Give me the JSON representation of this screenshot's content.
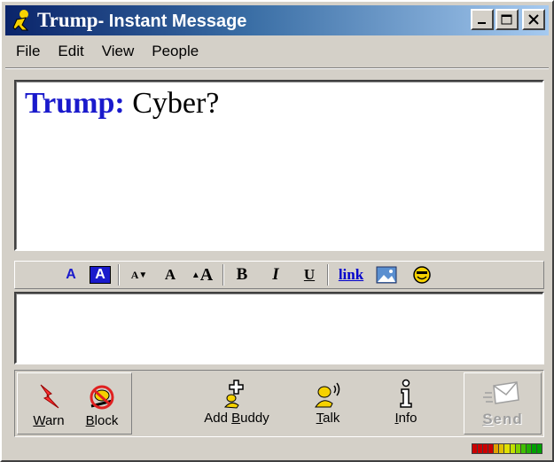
{
  "window": {
    "title_name": "Trump",
    "title_suffix": "- Instant Message"
  },
  "menu": {
    "items": [
      "File",
      "Edit",
      "View",
      "People"
    ]
  },
  "conversation": {
    "messages": [
      {
        "sender": "Trump:",
        "text": " Cyber?"
      }
    ]
  },
  "format_toolbar": {
    "text_color": "A",
    "background_color": "A",
    "smaller_font": "A",
    "normal_font": "A",
    "larger_font": "A",
    "bold": "B",
    "italic": "I",
    "underline": "U",
    "link": "link"
  },
  "compose": {
    "value": "",
    "placeholder": ""
  },
  "actions": {
    "warn": {
      "pre": "",
      "key": "W",
      "post": "arn"
    },
    "block": {
      "pre": "",
      "key": "B",
      "post": "lock"
    },
    "add_buddy": {
      "pre": "Add ",
      "key": "B",
      "post": "uddy"
    },
    "talk": {
      "pre": "",
      "key": "T",
      "post": "alk"
    },
    "info": {
      "pre": "",
      "key": "I",
      "post": "nfo"
    },
    "send": {
      "pre": "",
      "key": "S",
      "post": "end"
    }
  },
  "colors": {
    "title_gradient_start": "#0a246a",
    "title_gradient_end": "#a6caf0",
    "sender_color": "#1a1acc",
    "link_color": "#0000cc",
    "window_face": "#d4d0c8",
    "send_disabled": "#a0a0a0"
  },
  "warning_meter": {
    "colors": [
      "#cc0000",
      "#cc0000",
      "#cc0000",
      "#cc0000",
      "#e0a000",
      "#e0c000",
      "#e0e000",
      "#c0e000",
      "#80d000",
      "#40c000",
      "#20b000",
      "#00a000",
      "#00a000"
    ]
  }
}
